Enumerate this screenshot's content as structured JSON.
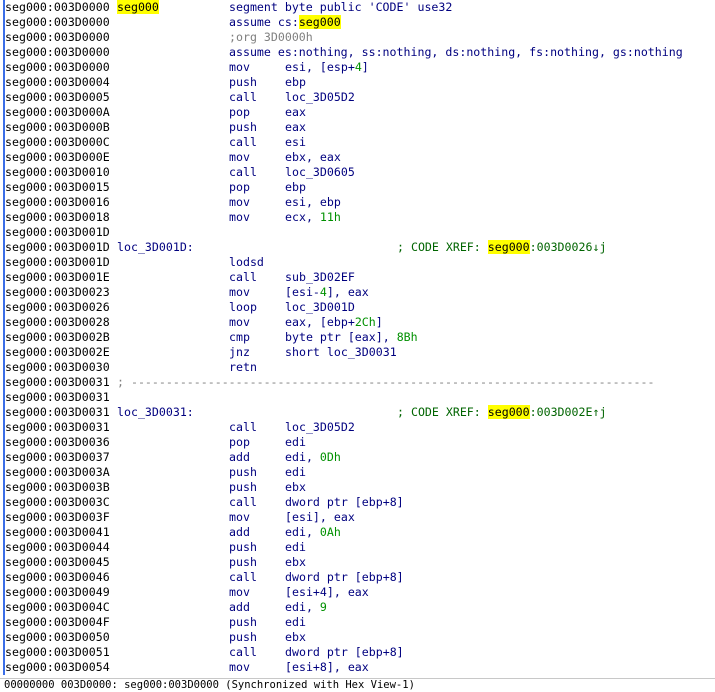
{
  "status_bar": "00000000 003D0000: seg000:003D0000 (Synchronized with Hex View-1)",
  "highlight_token": "seg000",
  "colors": {
    "address": "#000000",
    "code": "#00007f",
    "comment": "#006400",
    "number": "#009000",
    "highlight": "#ffff00"
  },
  "rows": [
    {
      "t": "label",
      "a": "seg000:003D0000",
      "l": "seg000",
      "d": "segment byte public 'CODE' use32"
    },
    {
      "t": "dir",
      "a": "seg000:003D0000",
      "d": "assume cs:seg000"
    },
    {
      "t": "dir",
      "a": "seg000:003D0000",
      "d": ";org 3D0000h",
      "g": true
    },
    {
      "t": "dir",
      "a": "seg000:003D0000",
      "d": "assume es:nothing, ss:nothing, ds:nothing, fs:nothing, gs:nothing"
    },
    {
      "t": "ins",
      "a": "seg000:003D0000",
      "m": "mov",
      "o": "esi, [esp+4]",
      "n": "4"
    },
    {
      "t": "ins",
      "a": "seg000:003D0004",
      "m": "push",
      "o": "ebp"
    },
    {
      "t": "ins",
      "a": "seg000:003D0005",
      "m": "call",
      "o": "loc_3D05D2"
    },
    {
      "t": "ins",
      "a": "seg000:003D000A",
      "m": "pop",
      "o": "eax"
    },
    {
      "t": "ins",
      "a": "seg000:003D000B",
      "m": "push",
      "o": "eax"
    },
    {
      "t": "ins",
      "a": "seg000:003D000C",
      "m": "call",
      "o": "esi"
    },
    {
      "t": "ins",
      "a": "seg000:003D000E",
      "m": "mov",
      "o": "ebx, eax"
    },
    {
      "t": "ins",
      "a": "seg000:003D0010",
      "m": "call",
      "o": "loc_3D0605"
    },
    {
      "t": "ins",
      "a": "seg000:003D0015",
      "m": "pop",
      "o": "ebp"
    },
    {
      "t": "ins",
      "a": "seg000:003D0016",
      "m": "mov",
      "o": "esi, ebp"
    },
    {
      "t": "ins",
      "a": "seg000:003D0018",
      "m": "mov",
      "o": "ecx, 11h",
      "n": "11h"
    },
    {
      "t": "blank",
      "a": "seg000:003D001D"
    },
    {
      "t": "xref",
      "a": "seg000:003D001D",
      "l": "loc_3D001D:",
      "c": "; CODE XREF: seg000:003D0026↓j"
    },
    {
      "t": "ins",
      "a": "seg000:003D001D",
      "m": "lodsd",
      "o": ""
    },
    {
      "t": "ins",
      "a": "seg000:003D001E",
      "m": "call",
      "o": "sub_3D02EF"
    },
    {
      "t": "ins",
      "a": "seg000:003D0023",
      "m": "mov",
      "o": "[esi-4], eax",
      "n": "4"
    },
    {
      "t": "ins",
      "a": "seg000:003D0026",
      "m": "loop",
      "o": "loc_3D001D"
    },
    {
      "t": "ins",
      "a": "seg000:003D0028",
      "m": "mov",
      "o": "eax, [ebp+2Ch]",
      "n": "2Ch"
    },
    {
      "t": "ins",
      "a": "seg000:003D002B",
      "m": "cmp",
      "o": "byte ptr [eax], 8Bh",
      "n": "8Bh"
    },
    {
      "t": "ins",
      "a": "seg000:003D002E",
      "m": "jnz",
      "o": "short loc_3D0031"
    },
    {
      "t": "ins",
      "a": "seg000:003D0030",
      "m": "retn",
      "o": ""
    },
    {
      "t": "sep",
      "a": "seg000:003D0031",
      "s": "; ---------------------------------------------------------------------------"
    },
    {
      "t": "blank",
      "a": "seg000:003D0031"
    },
    {
      "t": "xref",
      "a": "seg000:003D0031",
      "l": "loc_3D0031:",
      "c": "; CODE XREF: seg000:003D002E↑j"
    },
    {
      "t": "ins",
      "a": "seg000:003D0031",
      "m": "call",
      "o": "loc_3D05D2"
    },
    {
      "t": "ins",
      "a": "seg000:003D0036",
      "m": "pop",
      "o": "edi"
    },
    {
      "t": "ins",
      "a": "seg000:003D0037",
      "m": "add",
      "o": "edi, 0Dh",
      "n": "0Dh"
    },
    {
      "t": "ins",
      "a": "seg000:003D003A",
      "m": "push",
      "o": "edi"
    },
    {
      "t": "ins",
      "a": "seg000:003D003B",
      "m": "push",
      "o": "ebx"
    },
    {
      "t": "ins",
      "a": "seg000:003D003C",
      "m": "call",
      "o": "dword ptr [ebp+8]"
    },
    {
      "t": "ins",
      "a": "seg000:003D003F",
      "m": "mov",
      "o": "[esi], eax"
    },
    {
      "t": "ins",
      "a": "seg000:003D0041",
      "m": "add",
      "o": "edi, 0Ah",
      "n": "0Ah"
    },
    {
      "t": "ins",
      "a": "seg000:003D0044",
      "m": "push",
      "o": "edi"
    },
    {
      "t": "ins",
      "a": "seg000:003D0045",
      "m": "push",
      "o": "ebx"
    },
    {
      "t": "ins",
      "a": "seg000:003D0046",
      "m": "call",
      "o": "dword ptr [ebp+8]"
    },
    {
      "t": "ins",
      "a": "seg000:003D0049",
      "m": "mov",
      "o": "[esi+4], eax"
    },
    {
      "t": "ins",
      "a": "seg000:003D004C",
      "m": "add",
      "o": "edi, 9",
      "n": "9"
    },
    {
      "t": "ins",
      "a": "seg000:003D004F",
      "m": "push",
      "o": "edi"
    },
    {
      "t": "ins",
      "a": "seg000:003D0050",
      "m": "push",
      "o": "ebx"
    },
    {
      "t": "ins",
      "a": "seg000:003D0051",
      "m": "call",
      "o": "dword ptr [ebp+8]"
    },
    {
      "t": "ins",
      "a": "seg000:003D0054",
      "m": "mov",
      "o": "[esi+8], eax"
    }
  ]
}
